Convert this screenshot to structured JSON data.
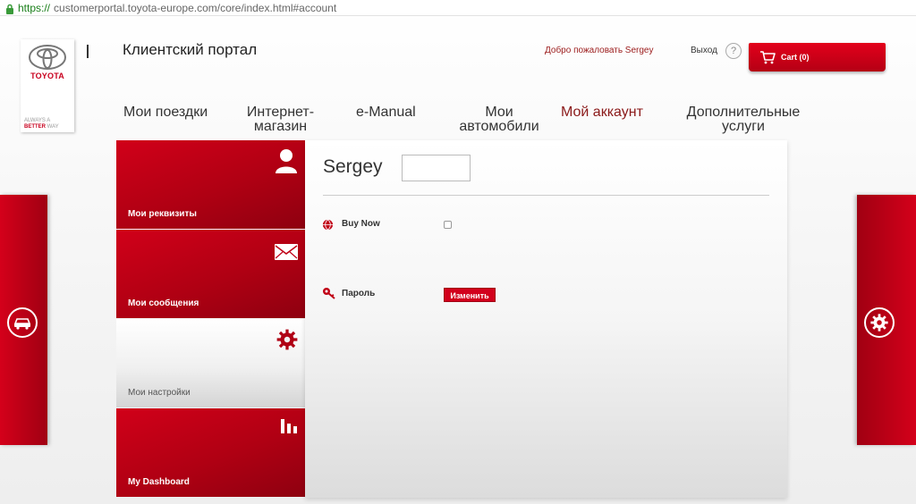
{
  "browser": {
    "url_protocol": "https://",
    "url_rest": "customerportal.toyota-europe.com/core/index.html#account"
  },
  "logo": {
    "brand": "TOYOTA",
    "slogan_line1": "ALWAYS A",
    "slogan_line2_a": "BETTER",
    "slogan_line2_b": " WAY"
  },
  "header": {
    "divider": "|",
    "portal_title": "Клиентский портал",
    "welcome": "Добро пожаловать Sergey",
    "logout": "Выход",
    "help": "?",
    "cart_label": "Cart (0)"
  },
  "nav": {
    "items": [
      {
        "label": "Мои поездки"
      },
      {
        "label": "Интернет-магазин"
      },
      {
        "label": "e-Manual"
      },
      {
        "label": "Мои автомобили"
      },
      {
        "label": "Мой аккаунт",
        "active": true
      },
      {
        "label": "Дополнительные услуги"
      }
    ]
  },
  "tiles": [
    {
      "label": "Мои реквизиты",
      "icon": "user-icon"
    },
    {
      "label": "Мои сообщения",
      "icon": "envelope-icon"
    },
    {
      "label": "Мои настройки",
      "icon": "gear-icon",
      "active": true
    },
    {
      "label": "My Dashboard",
      "icon": "bar-chart-icon"
    }
  ],
  "content": {
    "user_name": "Sergey",
    "buy_now_label": "Buy Now",
    "password_label": "Пароль",
    "change_button": "Изменить"
  },
  "side_icons": {
    "left": "car-icon",
    "right": "gear-icon"
  },
  "colors": {
    "brand_red": "#d10019",
    "nav_active": "#8b1a1a",
    "welcome_text": "#9b1b1b"
  }
}
